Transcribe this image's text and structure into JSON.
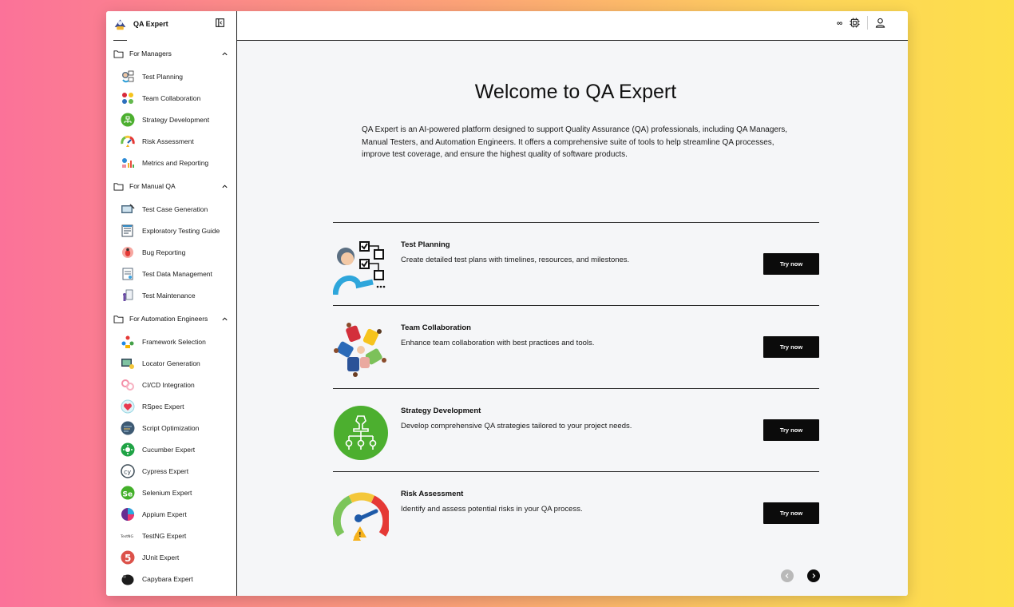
{
  "app": {
    "name": "QA Expert"
  },
  "topbar": {
    "infinity_glyph": "∞"
  },
  "sidebar": {
    "groups": [
      {
        "label": "For Managers",
        "items": [
          {
            "label": "Test Planning",
            "icon": "test-planning-icon"
          },
          {
            "label": "Team Collaboration",
            "icon": "team-collaboration-icon"
          },
          {
            "label": "Strategy Development",
            "icon": "strategy-icon"
          },
          {
            "label": "Risk Assessment",
            "icon": "gauge-icon"
          },
          {
            "label": "Metrics and Reporting",
            "icon": "metrics-icon"
          }
        ]
      },
      {
        "label": "For Manual QA",
        "items": [
          {
            "label": "Test Case Generation",
            "icon": "test-case-icon"
          },
          {
            "label": "Exploratory Testing Guide",
            "icon": "guide-icon"
          },
          {
            "label": "Bug Reporting",
            "icon": "bug-icon"
          },
          {
            "label": "Test Data Management",
            "icon": "data-icon"
          },
          {
            "label": "Test Maintenance",
            "icon": "maintenance-icon"
          }
        ]
      },
      {
        "label": "For Automation Engineers",
        "items": [
          {
            "label": "Framework Selection",
            "icon": "framework-icon"
          },
          {
            "label": "Locator Generation",
            "icon": "locator-icon"
          },
          {
            "label": "CI/CD Integration",
            "icon": "cicd-icon"
          },
          {
            "label": "RSpec Expert",
            "icon": "rspec-icon"
          },
          {
            "label": "Script Optimization",
            "icon": "script-icon"
          },
          {
            "label": "Cucumber Expert",
            "icon": "cucumber-icon"
          },
          {
            "label": "Cypress Expert",
            "icon": "cypress-icon"
          },
          {
            "label": "Selenium Expert",
            "icon": "selenium-icon"
          },
          {
            "label": "Appium Expert",
            "icon": "appium-icon"
          },
          {
            "label": "TestNG Expert",
            "icon": "testng-icon"
          },
          {
            "label": "JUnit Expert",
            "icon": "junit-icon"
          },
          {
            "label": "Capybara Expert",
            "icon": "capybara-icon"
          }
        ]
      }
    ]
  },
  "main": {
    "title": "Welcome to QA Expert",
    "intro": "QA Expert is an AI-powered platform designed to support Quality Assurance (QA) professionals, including QA Managers, Manual Testers, and Automation Engineers. It offers a comprehensive suite of tools to help streamline QA processes, improve test coverage, and ensure the highest quality of software products.",
    "cards": [
      {
        "title": "Test Planning",
        "desc": "Create detailed test plans with timelines, resources, and milestones.",
        "button": "Try now"
      },
      {
        "title": "Team Collaboration",
        "desc": "Enhance team collaboration with best practices and tools.",
        "button": "Try now"
      },
      {
        "title": "Strategy Development",
        "desc": "Develop comprehensive QA strategies tailored to your project needs.",
        "button": "Try now"
      },
      {
        "title": "Risk Assessment",
        "desc": "Identify and assess potential risks in your QA process.",
        "button": "Try now"
      }
    ]
  },
  "colors": {
    "accent": "#0b0b0b",
    "strategy_green": "#4caf2f",
    "page_bg": "#f5f6f8"
  },
  "testng_logo_text": "TestNG"
}
